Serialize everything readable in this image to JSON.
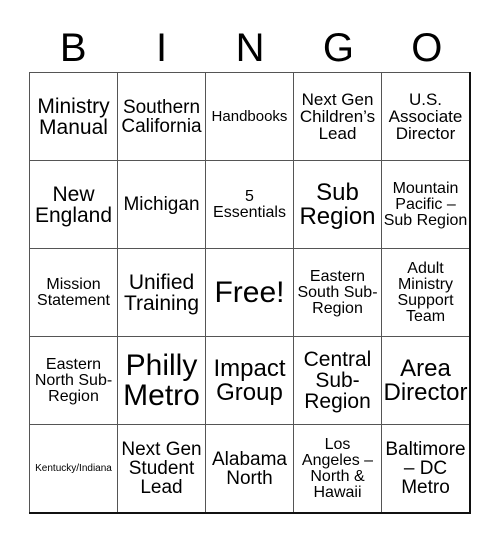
{
  "header": {
    "letters": [
      "B",
      "I",
      "N",
      "G",
      "O"
    ]
  },
  "grid": {
    "rows": [
      [
        "Ministry Manual",
        "Southern California",
        "Handbooks",
        "Next Gen Children’s Lead",
        "U.S. Associate Director"
      ],
      [
        "New England",
        "Michigan",
        "5 Essentials",
        "Sub Region",
        "Mountain Pacific – Sub Region"
      ],
      [
        "Mission Statement",
        "Unified Training",
        "Free!",
        "Eastern South Sub-Region",
        "Adult Ministry Support Team"
      ],
      [
        "Eastern North Sub-Region",
        "Philly Metro",
        "Impact Group",
        "Central Sub-Region",
        "Area Director"
      ],
      [
        "Kentucky/Indiana",
        "Next Gen Student Lead",
        "Alabama North",
        "Los Angeles – North & Hawaii",
        "Baltimore – DC Metro"
      ]
    ],
    "free_cell_label": "Free!"
  }
}
